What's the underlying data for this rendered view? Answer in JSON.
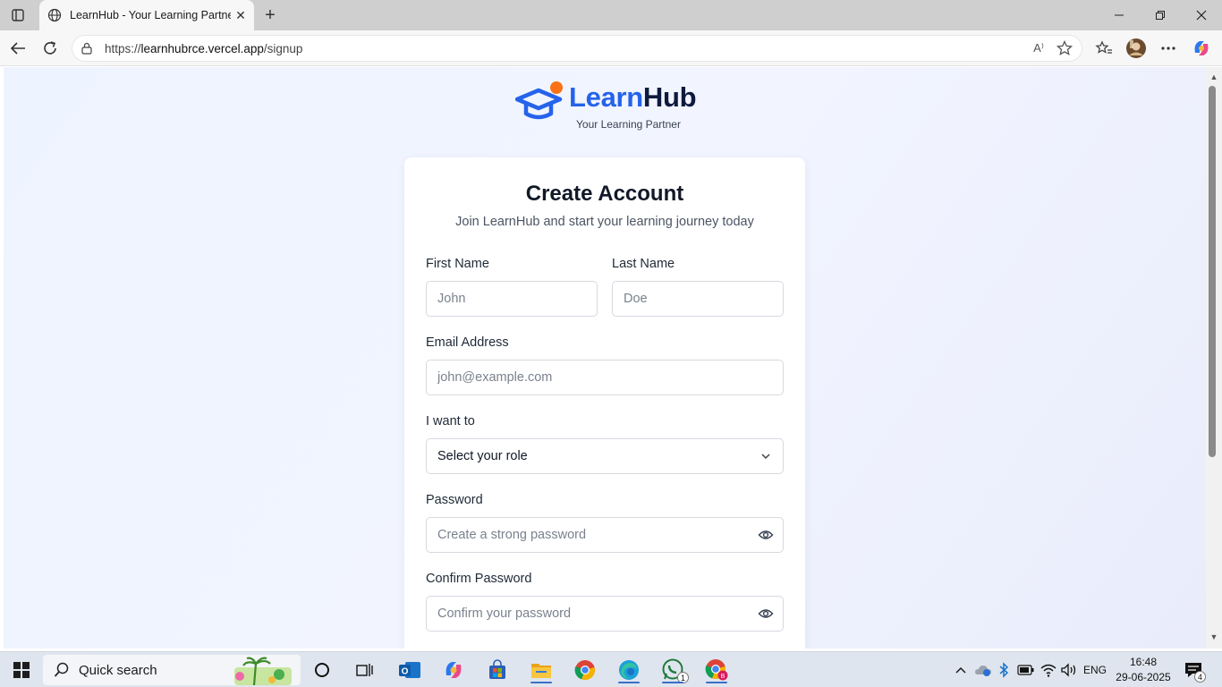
{
  "browser": {
    "tab_title": "LearnHub - Your Learning Partner",
    "url_prefix": "https://",
    "url_host": "learnhubrce.vercel.app",
    "url_path": "/signup",
    "read_aloud": "A⁾"
  },
  "logo": {
    "brand_part1": "Learn",
    "brand_part2": "Hub",
    "tagline": "Your Learning Partner",
    "colors": {
      "brand_blue": "#2563eb",
      "dark": "#0f1b3d",
      "dot": "#f97316"
    }
  },
  "form": {
    "title": "Create Account",
    "subtitle": "Join LearnHub and start your learning journey today",
    "first_name": {
      "label": "First Name",
      "placeholder": "John"
    },
    "last_name": {
      "label": "Last Name",
      "placeholder": "Doe"
    },
    "email": {
      "label": "Email Address",
      "placeholder": "john@example.com"
    },
    "role": {
      "label": "I want to",
      "value": "Select your role"
    },
    "password": {
      "label": "Password",
      "placeholder": "Create a strong password"
    },
    "confirm_password": {
      "label": "Confirm Password",
      "placeholder": "Confirm your password"
    }
  },
  "taskbar": {
    "search_text": "Quick search",
    "language": "ENG",
    "time": "16:48",
    "date": "29-06-2025",
    "whatsapp_badge": "1",
    "notification_count": "4"
  }
}
